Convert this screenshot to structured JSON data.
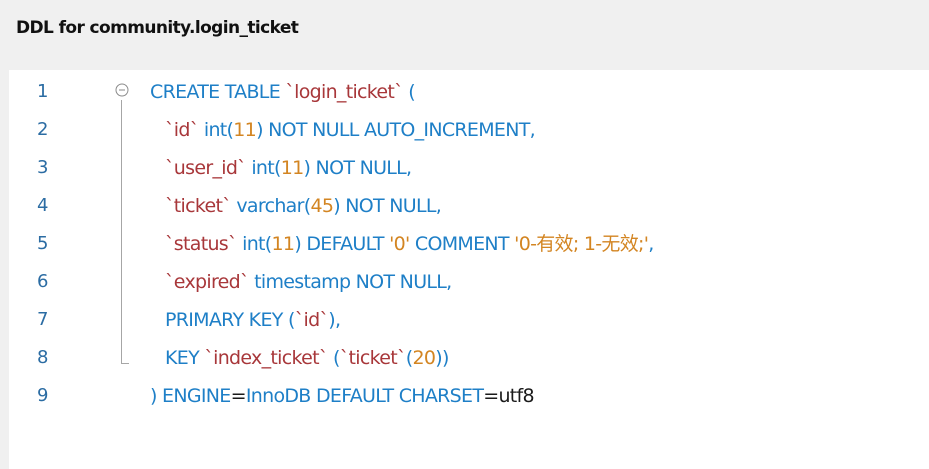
{
  "header": {
    "title": "DDL for community.login_ticket"
  },
  "editor": {
    "fold_icon": "fold-collapse-icon",
    "lines": [
      {
        "num": "1",
        "tokens": [
          {
            "t": "kw",
            "v": "CREATE TABLE "
          },
          {
            "t": "id",
            "v": "`login_ticket`"
          },
          {
            "t": "kw",
            "v": " ("
          }
        ]
      },
      {
        "num": "2",
        "tokens": [
          {
            "t": "id",
            "v": "`id`"
          },
          {
            "t": "kw",
            "v": " int("
          },
          {
            "t": "num",
            "v": "11"
          },
          {
            "t": "kw",
            "v": ") NOT NULL AUTO_INCREMENT,"
          }
        ]
      },
      {
        "num": "3",
        "tokens": [
          {
            "t": "id",
            "v": "`user_id`"
          },
          {
            "t": "kw",
            "v": " int("
          },
          {
            "t": "num",
            "v": "11"
          },
          {
            "t": "kw",
            "v": ") NOT NULL,"
          }
        ]
      },
      {
        "num": "4",
        "tokens": [
          {
            "t": "id",
            "v": "`ticket`"
          },
          {
            "t": "kw",
            "v": " varchar("
          },
          {
            "t": "num",
            "v": "45"
          },
          {
            "t": "kw",
            "v": ") NOT NULL,"
          }
        ]
      },
      {
        "num": "5",
        "tokens": [
          {
            "t": "id",
            "v": "`status`"
          },
          {
            "t": "kw",
            "v": " int("
          },
          {
            "t": "num",
            "v": "11"
          },
          {
            "t": "kw",
            "v": ") DEFAULT "
          },
          {
            "t": "str",
            "v": "'0'"
          },
          {
            "t": "kw",
            "v": " COMMENT "
          },
          {
            "t": "str",
            "v": "'0-有效; 1-无效;'"
          },
          {
            "t": "kw",
            "v": ","
          }
        ]
      },
      {
        "num": "6",
        "tokens": [
          {
            "t": "id",
            "v": "`expired`"
          },
          {
            "t": "kw",
            "v": " timestamp NOT NULL,"
          }
        ]
      },
      {
        "num": "7",
        "tokens": [
          {
            "t": "kw",
            "v": "PRIMARY KEY ("
          },
          {
            "t": "id",
            "v": "`id`"
          },
          {
            "t": "kw",
            "v": "),"
          }
        ]
      },
      {
        "num": "8",
        "tokens": [
          {
            "t": "kw",
            "v": "KEY "
          },
          {
            "t": "id",
            "v": "`index_ticket`"
          },
          {
            "t": "kw",
            "v": " ("
          },
          {
            "t": "id",
            "v": "`ticket`"
          },
          {
            "t": "kw",
            "v": "("
          },
          {
            "t": "num",
            "v": "20"
          },
          {
            "t": "kw",
            "v": "))"
          }
        ]
      },
      {
        "num": "9",
        "tokens": [
          {
            "t": "kw",
            "v": ") ENGINE"
          },
          {
            "t": "plain",
            "v": "="
          },
          {
            "t": "kw",
            "v": "InnoDB DEFAULT CHARSET"
          },
          {
            "t": "plain",
            "v": "=utf8"
          }
        ]
      }
    ]
  },
  "colors": {
    "keyword": "#1e7fc7",
    "identifier": "#a8373a",
    "number": "#d38522",
    "string": "#d38522",
    "line_number": "#2b6ca3",
    "editor_background": "#ffffff",
    "window_background": "#f0f0f0"
  }
}
